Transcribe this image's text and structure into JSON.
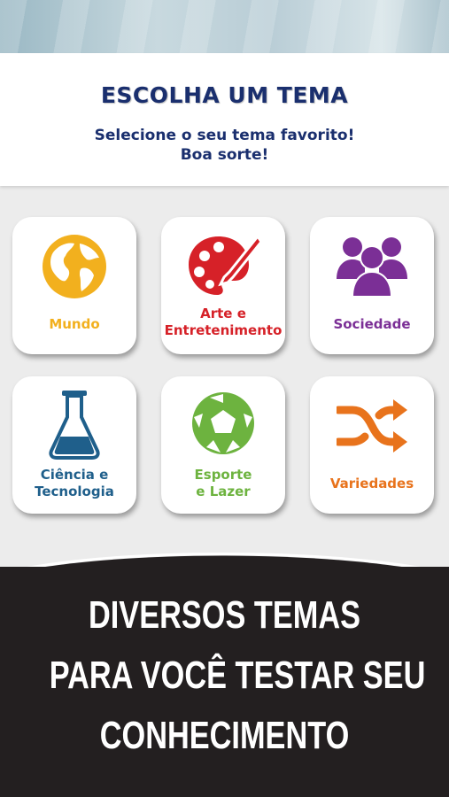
{
  "header": {
    "title": "ESCOLHA UM TEMA",
    "subtitle_line1": "Selecione o seu tema favorito!",
    "subtitle_line2": "Boa sorte!"
  },
  "themes": [
    {
      "line1": "Mundo",
      "line2": "",
      "icon": "globe-icon",
      "color": "#f2b01e"
    },
    {
      "line1": "Arte e",
      "line2": "Entretenimento",
      "icon": "palette-icon",
      "color": "#d62128"
    },
    {
      "line1": "Sociedade",
      "line2": "",
      "icon": "people-icon",
      "color": "#7b2f96"
    },
    {
      "line1": "Ciência e",
      "line2": "Tecnologia",
      "icon": "flask-icon",
      "color": "#1f5f8b"
    },
    {
      "line1": "Esporte",
      "line2": "e Lazer",
      "icon": "soccer-ball-icon",
      "color": "#6db33f"
    },
    {
      "line1": "Variedades",
      "line2": "",
      "icon": "shuffle-icon",
      "color": "#e8731c"
    }
  ],
  "promo": {
    "line1": "DIVERSOS TEMAS",
    "line2": "PARA VOCÊ TESTAR SEU",
    "line3": "CONHECIMENTO"
  }
}
